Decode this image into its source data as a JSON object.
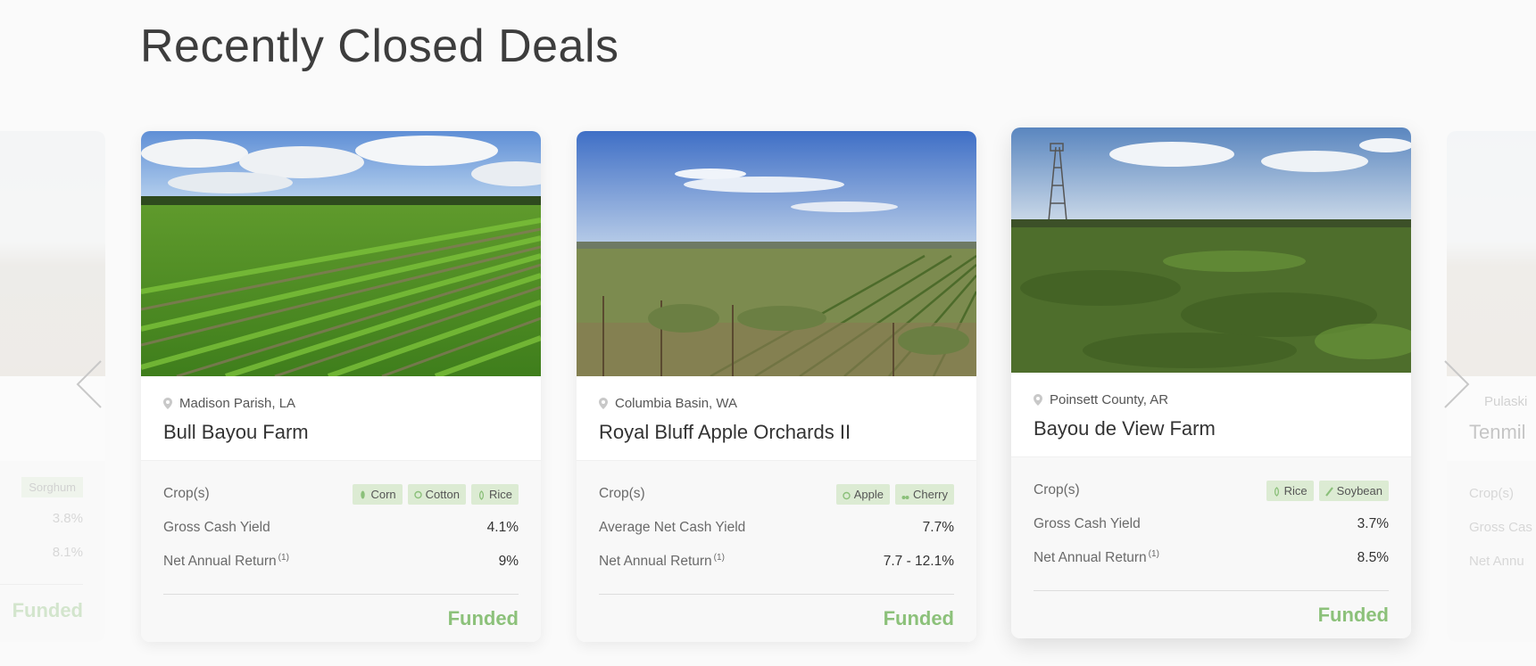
{
  "page": {
    "title": "Recently Closed Deals"
  },
  "nav": {
    "prev_icon": "chevron-left-icon",
    "next_icon": "chevron-right-icon"
  },
  "left_partial": {
    "crop": "Sorghum",
    "yield": "3.8%",
    "return": "8.1%",
    "status": "Funded"
  },
  "cards": [
    {
      "location": "Madison Parish, LA",
      "name": "Bull Bayou Farm",
      "crops_label": "Crop(s)",
      "crops": [
        "Corn",
        "Cotton",
        "Rice"
      ],
      "yield_label": "Gross Cash Yield",
      "yield": "4.1%",
      "return_label": "Net Annual Return",
      "return_note": "(1)",
      "return": "9%",
      "status": "Funded"
    },
    {
      "location": "Columbia Basin, WA",
      "name": "Royal Bluff Apple Orchards II",
      "crops_label": "Crop(s)",
      "crops": [
        "Apple",
        "Cherry"
      ],
      "yield_label": "Average Net Cash Yield",
      "yield": "7.7%",
      "return_label": "Net Annual Return",
      "return_note": "(1)",
      "return": "7.7 - 12.1%",
      "status": "Funded"
    },
    {
      "location": "Poinsett County, AR",
      "name": "Bayou de View Farm",
      "crops_label": "Crop(s)",
      "crops": [
        "Rice",
        "Soybean"
      ],
      "yield_label": "Gross Cash Yield",
      "yield": "3.7%",
      "return_label": "Net Annual Return",
      "return_note": "(1)",
      "return": "8.5%",
      "status": "Funded"
    }
  ],
  "right_partial": {
    "location": "Pulaski",
    "name": "Tenmil",
    "crops_label": "Crop(s)",
    "yield_label": "Gross Cas",
    "return_label": "Net Annu"
  },
  "colors": {
    "accent": "#8cc17a",
    "chip_bg": "#dcebd3"
  }
}
